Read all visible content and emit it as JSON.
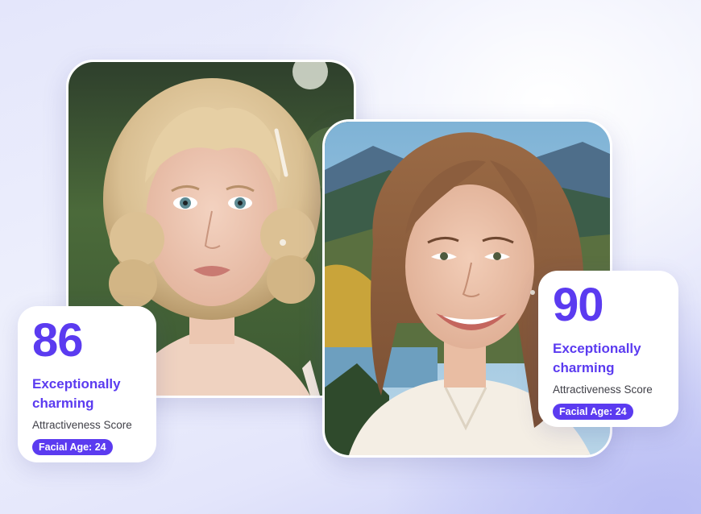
{
  "cards": [
    {
      "score": "86",
      "title": "Exceptionally charming",
      "label": "Attractiveness Score",
      "age_badge": "Facial Age: 24"
    },
    {
      "score": "90",
      "title": "Exceptionally charming",
      "label": "Attractiveness Score",
      "age_badge": "Facial Age: 24"
    }
  ],
  "photos": [
    {
      "subject": "woman-blonde-curly-hair-portrait"
    },
    {
      "subject": "woman-smiling-mountain-lake-portrait"
    }
  ],
  "colors": {
    "accent": "#5b3bf0",
    "card_bg": "#ffffff",
    "label_text": "#404048"
  }
}
